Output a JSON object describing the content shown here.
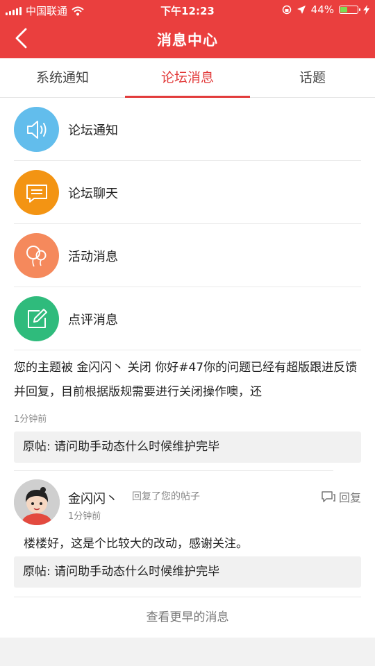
{
  "status": {
    "carrier": "中国联通",
    "time": "下午12:23",
    "battery": "44%",
    "battery_level": 0.44
  },
  "header": {
    "title": "消息中心"
  },
  "tabs": [
    {
      "label": "系统通知",
      "active": false
    },
    {
      "label": "论坛消息",
      "active": true
    },
    {
      "label": "话题",
      "active": false
    }
  ],
  "categories": [
    {
      "label": "论坛通知",
      "icon": "speaker-icon",
      "color": "#62bdec"
    },
    {
      "label": "论坛聊天",
      "icon": "chat-bubble-icon",
      "color": "#f39413"
    },
    {
      "label": "活动消息",
      "icon": "balloons-icon",
      "color": "#f5895c"
    },
    {
      "label": "点评消息",
      "icon": "edit-icon",
      "color": "#2fbb7c"
    }
  ],
  "notice": {
    "text": "您的主题被 金闪闪丶 关闭 你好#47你的问题已经有超版跟进反馈并回复，目前根据版规需要进行关闭操作噢，还",
    "time": "1分钟前",
    "quote": "原帖: 请问助手动态什么时候维护完毕"
  },
  "reply": {
    "user": "金闪闪丶",
    "action": "回复了您的帖子",
    "time": "1分钟前",
    "reply_label": "回复",
    "text": "楼楼好，这是个比较大的改动，感谢关注。",
    "quote": "原帖: 请问助手动态什么时候维护完毕"
  },
  "more_label": "查看更早的消息"
}
